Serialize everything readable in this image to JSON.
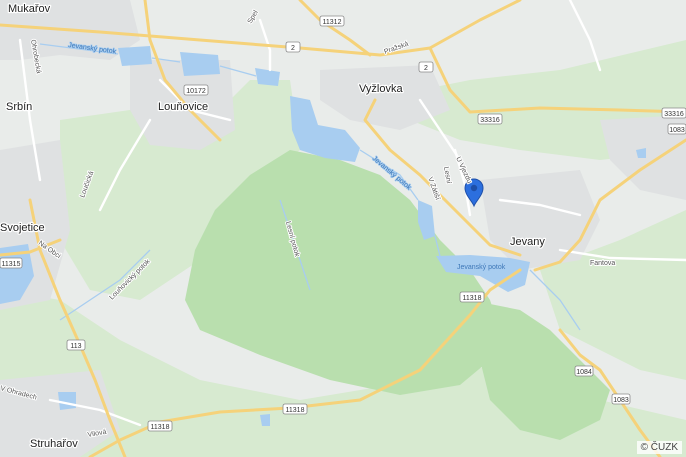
{
  "map": {
    "attribution": "© ČUZK",
    "marker": {
      "name": "location-pin"
    },
    "towns": [
      {
        "key": "mukarov",
        "label": "Mukařov"
      },
      {
        "key": "srbin",
        "label": "Srbín"
      },
      {
        "key": "lounovice",
        "label": "Louňovice"
      },
      {
        "key": "vyzlovka",
        "label": "Vyžlovka"
      },
      {
        "key": "svojetice",
        "label": "Svojetice"
      },
      {
        "key": "jevany",
        "label": "Jevany"
      },
      {
        "key": "struharov",
        "label": "Struhařov"
      }
    ],
    "streets": [
      {
        "key": "ohrobecka",
        "label": "Ohrobecká"
      },
      {
        "key": "prazska",
        "label": "Pražská"
      },
      {
        "key": "spel",
        "label": "Spel"
      },
      {
        "key": "loucka",
        "label": "Loučická"
      },
      {
        "key": "na-obci",
        "label": "Na Obci"
      },
      {
        "key": "u-vjezdu",
        "label": "U Vjezdu"
      },
      {
        "key": "lesni",
        "label": "Lesní"
      },
      {
        "key": "v-zatisi",
        "label": "V Zátiší"
      },
      {
        "key": "fantova",
        "label": "Fantova"
      },
      {
        "key": "vilova",
        "label": "Vilová"
      },
      {
        "key": "ohradech",
        "label": "V Ohradech"
      }
    ],
    "waterways": [
      {
        "key": "jevansky-1",
        "label": "Jevanský potok"
      },
      {
        "key": "jevansky-2",
        "label": "Jevanský potok"
      },
      {
        "key": "jevansky-3",
        "label": "Jevanský potok"
      },
      {
        "key": "lesni-potok",
        "label": "Lesní potok"
      },
      {
        "key": "lounovicky",
        "label": "Louňovický potok"
      }
    ],
    "road_numbers": [
      {
        "key": "r11312",
        "label": "11312"
      },
      {
        "key": "r2a",
        "label": "2"
      },
      {
        "key": "r2b",
        "label": "2"
      },
      {
        "key": "r10172",
        "label": "10172"
      },
      {
        "key": "r33316a",
        "label": "33316"
      },
      {
        "key": "r33316b",
        "label": "33316"
      },
      {
        "key": "r1083a",
        "label": "1083"
      },
      {
        "key": "r11315",
        "label": "11315"
      },
      {
        "key": "r11318a",
        "label": "11318"
      },
      {
        "key": "r11318b",
        "label": "11318"
      },
      {
        "key": "r11318c",
        "label": "11318"
      },
      {
        "key": "r113",
        "label": "113"
      },
      {
        "key": "r1084",
        "label": "1084"
      },
      {
        "key": "r1083b",
        "label": "1083"
      }
    ]
  }
}
